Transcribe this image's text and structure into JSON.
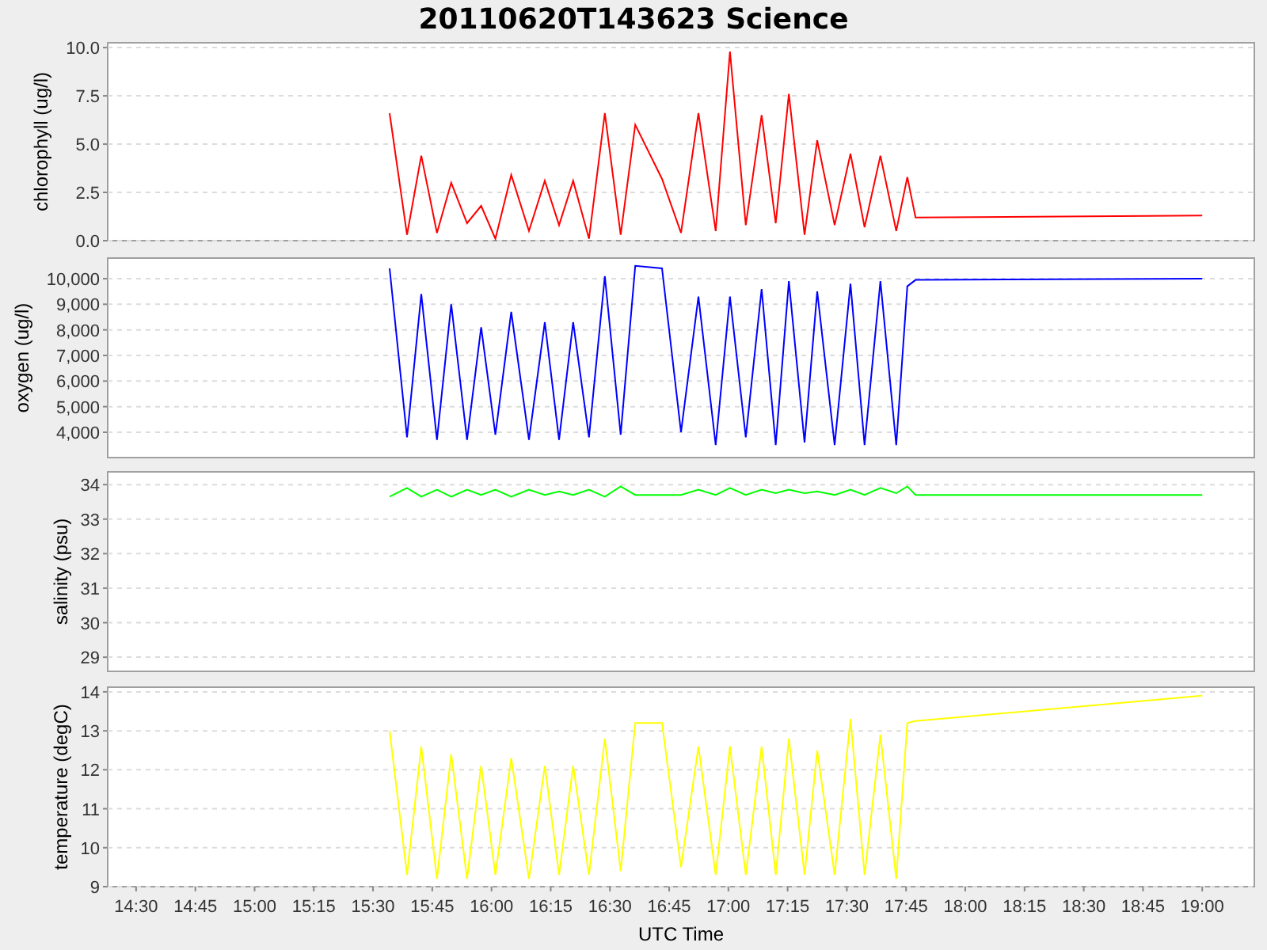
{
  "title": "20110620T143623 Science",
  "charts": [
    {
      "chart_data": {
        "type": "line",
        "grid": true,
        "ylabel": "chlorophyll (ug/l)",
        "xlim": [
          862.8,
          1153.2
        ],
        "ylim": [
          0,
          10.25
        ],
        "yticks": [
          {
            "value": 0,
            "label": "0.0"
          },
          {
            "value": 2.5,
            "label": "2.5"
          },
          {
            "value": 5,
            "label": "5.0"
          },
          {
            "value": 7.5,
            "label": "7.5"
          },
          {
            "value": 10,
            "label": "10.0"
          }
        ],
        "x": [
          934.2,
          938.6,
          942.2,
          946.2,
          949.8,
          953.8,
          957.4,
          961,
          965,
          969.5,
          973.5,
          977.1,
          980.7,
          984.7,
          988.7,
          992.7,
          996.4,
          1003.2,
          1008,
          1012.4,
          1016.8,
          1020.4,
          1024.4,
          1028.4,
          1032,
          1035.3,
          1039.3,
          1042.5,
          1046.9,
          1050.9,
          1054.5,
          1058.5,
          1062.5,
          1065.3,
          1067.4,
          1140
        ],
        "series": [
          {
            "color": "#ff0000",
            "values": [
              6.6,
              0.3,
              4.4,
              0.4,
              3.0,
              0.9,
              1.8,
              0.1,
              3.4,
              0.5,
              3.1,
              0.8,
              3.1,
              0.1,
              6.6,
              0.3,
              6.0,
              3.2,
              0.4,
              6.6,
              0.5,
              9.8,
              0.8,
              6.5,
              0.9,
              7.6,
              0.3,
              5.2,
              0.8,
              4.5,
              0.7,
              4.4,
              0.5,
              3.3,
              1.2,
              1.3
            ]
          }
        ]
      }
    },
    {
      "chart_data": {
        "type": "line",
        "grid": true,
        "ylabel": "oxygen (ug/l)",
        "xlim": [
          862.8,
          1153.2
        ],
        "ylim": [
          3010,
          10804
        ],
        "yticks": [
          {
            "value": 4000,
            "label": "4,000"
          },
          {
            "value": 5000,
            "label": "5,000"
          },
          {
            "value": 6000,
            "label": "6,000"
          },
          {
            "value": 7000,
            "label": "7,000"
          },
          {
            "value": 8000,
            "label": "8,000"
          },
          {
            "value": 9000,
            "label": "9,000"
          },
          {
            "value": 10000,
            "label": "10,000"
          }
        ],
        "x": [
          934.2,
          938.6,
          942.2,
          946.2,
          949.8,
          953.8,
          957.4,
          961,
          965,
          969.5,
          973.5,
          977.1,
          980.7,
          984.7,
          988.7,
          992.7,
          996.4,
          1003.2,
          1008,
          1012.4,
          1016.8,
          1020.4,
          1024.4,
          1028.4,
          1032,
          1035.3,
          1039.3,
          1042.5,
          1046.9,
          1050.9,
          1054.5,
          1058.5,
          1062.5,
          1065.3,
          1067.4,
          1140
        ],
        "series": [
          {
            "color": "#0000ff",
            "values": [
              10400,
              3800,
              9400,
              3700,
              9000,
              3700,
              8100,
              3900,
              8700,
              3700,
              8300,
              3700,
              8300,
              3800,
              10100,
              3900,
              10500,
              10400,
              4000,
              9300,
              3500,
              9300,
              3800,
              9600,
              3500,
              9900,
              3600,
              9500,
              3500,
              9800,
              3500,
              9900,
              3500,
              9700,
              9950,
              10000
            ]
          }
        ]
      }
    },
    {
      "chart_data": {
        "type": "line",
        "grid": true,
        "ylabel": "salinity (psu)",
        "xlim": [
          862.8,
          1153.2
        ],
        "ylim": [
          28.59,
          34.37
        ],
        "yticks": [
          29,
          30,
          31,
          32,
          33,
          34
        ],
        "x": [
          934.2,
          938.6,
          942.2,
          946.2,
          949.8,
          953.8,
          957.4,
          961,
          965,
          969.5,
          973.5,
          977.1,
          980.7,
          984.7,
          988.7,
          992.7,
          996.4,
          1003.2,
          1008,
          1012.4,
          1016.8,
          1020.4,
          1024.4,
          1028.4,
          1032,
          1035.3,
          1039.3,
          1042.5,
          1046.9,
          1050.9,
          1054.5,
          1058.5,
          1062.5,
          1065.3,
          1067.4,
          1140
        ],
        "series": [
          {
            "color": "#00ff00",
            "values": [
              33.65,
              33.9,
              33.65,
              33.85,
              33.65,
              33.85,
              33.7,
              33.85,
              33.65,
              33.85,
              33.7,
              33.8,
              33.7,
              33.85,
              33.65,
              33.95,
              33.7,
              33.7,
              33.7,
              33.85,
              33.7,
              33.9,
              33.7,
              33.85,
              33.75,
              33.85,
              33.75,
              33.8,
              33.7,
              33.85,
              33.7,
              33.9,
              33.75,
              33.95,
              33.7,
              33.7
            ]
          }
        ]
      }
    },
    {
      "chart_data": {
        "type": "line",
        "grid": true,
        "xlabel": "UTC Time",
        "ylabel": "temperature (degC)",
        "xlim": [
          862.8,
          1153.2
        ],
        "ylim": [
          9,
          14.12
        ],
        "yticks": [
          9,
          10,
          11,
          12,
          13,
          14
        ],
        "xticks": [
          {
            "value": 870,
            "label": "14:30"
          },
          {
            "value": 885,
            "label": "14:45"
          },
          {
            "value": 900,
            "label": "15:00"
          },
          {
            "value": 915,
            "label": "15:15"
          },
          {
            "value": 930,
            "label": "15:30"
          },
          {
            "value": 945,
            "label": "15:45"
          },
          {
            "value": 960,
            "label": "16:00"
          },
          {
            "value": 975,
            "label": "16:15"
          },
          {
            "value": 990,
            "label": "16:30"
          },
          {
            "value": 1005,
            "label": "16:45"
          },
          {
            "value": 1020,
            "label": "17:00"
          },
          {
            "value": 1035,
            "label": "17:15"
          },
          {
            "value": 1050,
            "label": "17:30"
          },
          {
            "value": 1065,
            "label": "17:45"
          },
          {
            "value": 1080,
            "label": "18:00"
          },
          {
            "value": 1095,
            "label": "18:15"
          },
          {
            "value": 1110,
            "label": "18:30"
          },
          {
            "value": 1125,
            "label": "18:45"
          },
          {
            "value": 1140,
            "label": "19:00"
          }
        ],
        "x": [
          934.2,
          938.6,
          942.2,
          946.2,
          949.8,
          953.8,
          957.4,
          961,
          965,
          969.5,
          973.5,
          977.1,
          980.7,
          984.7,
          988.7,
          992.7,
          996.4,
          1003.2,
          1008,
          1012.4,
          1016.8,
          1020.4,
          1024.4,
          1028.4,
          1032,
          1035.3,
          1039.3,
          1042.5,
          1046.9,
          1050.9,
          1054.5,
          1058.5,
          1062.5,
          1065.3,
          1067.4,
          1140
        ],
        "series": [
          {
            "color": "#ffff00",
            "values": [
              13.0,
              9.3,
              12.6,
              9.2,
              12.4,
              9.2,
              12.1,
              9.3,
              12.3,
              9.2,
              12.1,
              9.3,
              12.1,
              9.3,
              12.8,
              9.4,
              13.2,
              13.2,
              9.5,
              12.6,
              9.3,
              12.6,
              9.3,
              12.6,
              9.3,
              12.8,
              9.3,
              12.5,
              9.3,
              13.3,
              9.3,
              12.9,
              9.2,
              13.2,
              13.25,
              13.9
            ]
          }
        ]
      }
    }
  ]
}
